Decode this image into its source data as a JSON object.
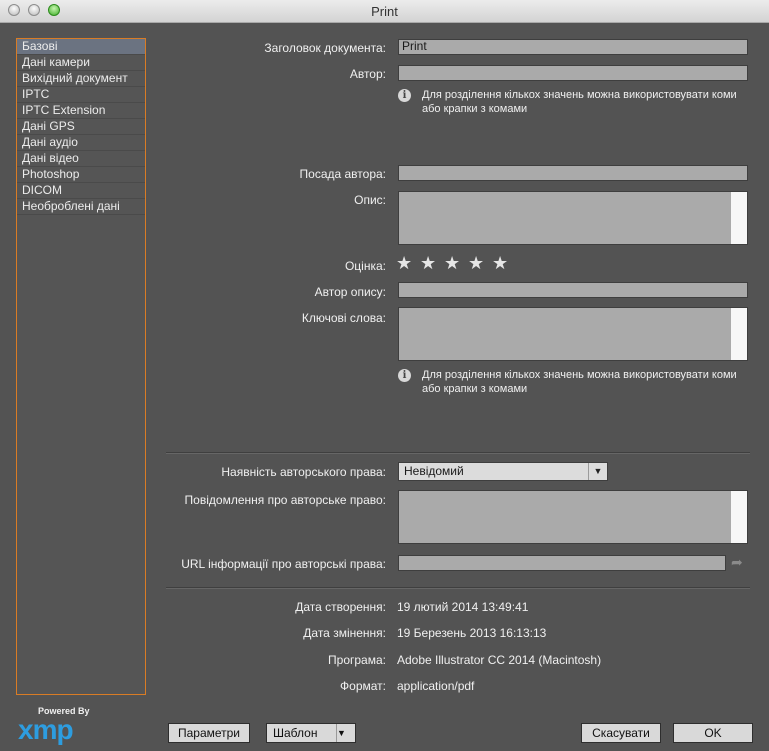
{
  "window": {
    "title": "Print"
  },
  "sidebar": {
    "items": [
      {
        "label": "Базові"
      },
      {
        "label": "Дані камери"
      },
      {
        "label": "Вихідний документ"
      },
      {
        "label": "IPTC"
      },
      {
        "label": "IPTC Extension"
      },
      {
        "label": "Дані GPS"
      },
      {
        "label": "Дані аудіо"
      },
      {
        "label": "Дані відео"
      },
      {
        "label": "Photoshop"
      },
      {
        "label": "DICOM"
      },
      {
        "label": "Необроблені дані"
      }
    ],
    "selected_index": 0
  },
  "branding": {
    "powered_by": "Powered By",
    "logo_text": "xmp",
    "logo_color": "#2d9de0"
  },
  "form": {
    "doc_title": {
      "label": "Заголовок документа:",
      "value": "Print"
    },
    "author": {
      "label": "Автор:",
      "value": ""
    },
    "author_hint": "Для розділення кількох значень можна використовувати коми або крапки з комами",
    "author_position": {
      "label": "Посада автора:",
      "value": ""
    },
    "description": {
      "label": "Опис:",
      "value": ""
    },
    "rating": {
      "label": "Оцінка:",
      "value": 0,
      "max": 5
    },
    "description_writer": {
      "label": "Автор опису:",
      "value": ""
    },
    "keywords": {
      "label": "Ключові слова:",
      "value": ""
    },
    "keywords_hint": "Для розділення кількох значень можна використовувати коми або крапки з комами",
    "copyright_status": {
      "label": "Наявність авторського права:",
      "value": "Невідомий"
    },
    "copyright_notice": {
      "label": "Повідомлення про авторське право:",
      "value": ""
    },
    "copyright_url": {
      "label": "URL інформації про авторські права:",
      "value": ""
    },
    "created": {
      "label": "Дата створення:",
      "value": "19  лютий  2014 13:49:41"
    },
    "modified": {
      "label": "Дата змінення:",
      "value": "19  Березень  2013 16:13:13"
    },
    "application": {
      "label": "Програма:",
      "value": "Adobe Illustrator CC 2014 (Macintosh)"
    },
    "format": {
      "label": "Формат:",
      "value": "application/pdf"
    }
  },
  "footer": {
    "preferences_label": "Параметри",
    "template_label": "Шаблон",
    "cancel_label": "Скасувати",
    "ok_label": "OK"
  },
  "colors": {
    "accent": "#d97c25",
    "selection": "#6b7381"
  }
}
